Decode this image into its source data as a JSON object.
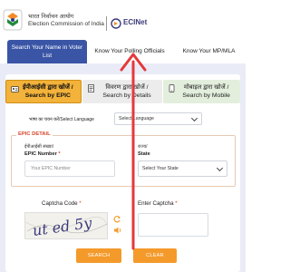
{
  "header": {
    "org_hindi": "भारत निर्वाचन आयोग",
    "org_english": "Election Commission of India",
    "brand": "ECINet"
  },
  "top_tabs": [
    {
      "label": "Search Your Name in Voter List",
      "active": true
    },
    {
      "label": "Know Your Polling Officials",
      "active": false
    },
    {
      "label": "Know Your MP/MLA",
      "active": false
    }
  ],
  "search_tabs": [
    {
      "label_hi": "ईपीआईसी द्वारा खोजें /",
      "label_en": "Search by EPIC",
      "icon": "id-card-icon",
      "active": true
    },
    {
      "label_hi": "विवरण द्वारा खोजें /",
      "label_en": "Search by Details",
      "icon": "document-icon",
      "active": false
    },
    {
      "label_hi": "मोबाइल द्वारा खोजें /",
      "label_en": "Search by Mobile",
      "icon": "mobile-icon",
      "active": false
    }
  ],
  "language": {
    "label": "भाषा का चयन करें/Select Language",
    "placeholder": "Select Language"
  },
  "epic_detail": {
    "legend": "EPIC DETAIL",
    "epic_hi": "ईपीआईसी संख्या/",
    "epic_label": "EPIC Number",
    "epic_placeholder": "Your EPIC Number",
    "state_hi": "राज्य/",
    "state_label": "State",
    "state_placeholder": "Select Your State"
  },
  "captcha": {
    "code_label": "Captcha Code",
    "enter_label": "Enter Captcha",
    "image_text": "ut ed 5y",
    "required_mark": "*"
  },
  "buttons": {
    "search": "SEARCH",
    "clear": "CLEAR"
  },
  "colors": {
    "primary": "#3a55a6",
    "accent": "#f3b23a",
    "button": "#f49a2b",
    "required": "#d7442a",
    "annotation_arrow": "#e5383b"
  }
}
